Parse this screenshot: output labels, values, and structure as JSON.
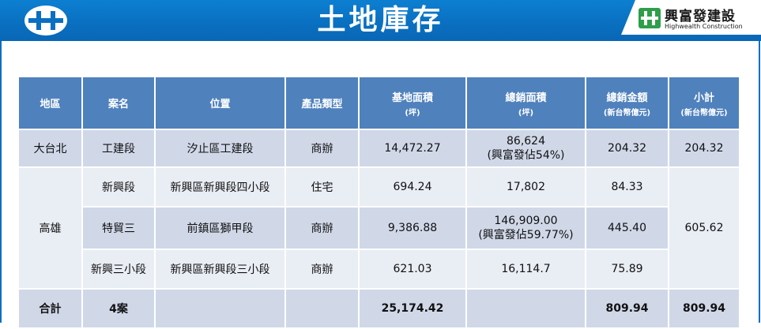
{
  "page": {
    "title": "土地庫存"
  },
  "brand": {
    "name_cn": "興富發建設",
    "name_en": "Highwealth Construction",
    "primary_color": "#0a6fc0",
    "header_color": "#4f81bd"
  },
  "table": {
    "headers": [
      {
        "main": "地區",
        "sub": ""
      },
      {
        "main": "案名",
        "sub": ""
      },
      {
        "main": "位置",
        "sub": ""
      },
      {
        "main": "產品類型",
        "sub": ""
      },
      {
        "main": "基地面積",
        "sub": "(坪)"
      },
      {
        "main": "總銷面積",
        "sub": "(坪)"
      },
      {
        "main": "總銷金額",
        "sub": "(新台幣億元)"
      },
      {
        "main": "小計",
        "sub": "(新台幣億元)"
      }
    ],
    "rows": [
      {
        "region": "大台北",
        "name": "工建段",
        "location": "汐止區工建段",
        "type": "商辦",
        "site_area": "14,472.27",
        "sales_area": "86,624",
        "sales_area_note": "(興富發佔54%)",
        "sales_amount": "204.32",
        "subtotal": "204.32"
      },
      {
        "region": "高雄",
        "name": "新興段",
        "location": "新興區新興段四小段",
        "type": "住宅",
        "site_area": "694.24",
        "sales_area": "17,802",
        "sales_area_note": "",
        "sales_amount": "84.33",
        "subtotal": "605.62"
      },
      {
        "region": "",
        "name": "特貿三",
        "location": "前鎮區獅甲段",
        "type": "商辦",
        "site_area": "9,386.88",
        "sales_area": "146,909.00",
        "sales_area_note": "(興富發佔59.77%)",
        "sales_amount": "445.40",
        "subtotal": ""
      },
      {
        "region": "",
        "name": "新興三小段",
        "location": "新興區新興段三小段",
        "type": "商辦",
        "site_area": "621.03",
        "sales_area": "16,114.7",
        "sales_area_note": "",
        "sales_amount": "75.89",
        "subtotal": ""
      }
    ],
    "total": {
      "label": "合計",
      "count": "4案",
      "site_area": "25,174.42",
      "sales_amount": "809.94",
      "subtotal": "809.94"
    }
  }
}
